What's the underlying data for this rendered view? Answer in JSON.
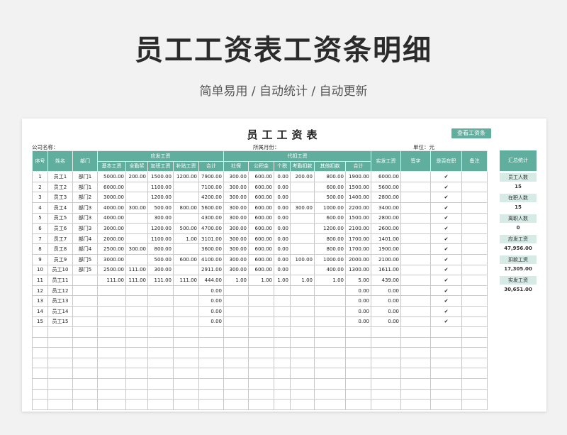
{
  "page": {
    "title": "员工工资表工资条明细",
    "subtitle": "简单易用  /  自动统计  /  自动更新"
  },
  "sheet": {
    "title": "员工工资表",
    "view_button": "查看工资条",
    "company_label": "公司名称：",
    "month_label": "所属月份：",
    "unit_label": "单位：元"
  },
  "headers": {
    "seq": "序号",
    "name": "姓名",
    "dept": "部门",
    "payable_group": "应发工资",
    "withhold_group": "代扣工资",
    "base": "基本工资",
    "attendance": "全勤奖",
    "overtime": "加班工资",
    "allowance": "补贴工资",
    "payable_total": "合计",
    "social": "社保",
    "fund": "公积金",
    "tax": "个税",
    "absence": "考勤扣款",
    "other": "其他扣款",
    "withhold_total": "合计",
    "net": "实发工资",
    "sign": "签字",
    "employed": "是否在职",
    "remark": "备注"
  },
  "rows": [
    [
      "1",
      "员工1",
      "部门1",
      "5000.00",
      "200.00",
      "1500.00",
      "1200.00",
      "7900.00",
      "300.00",
      "600.00",
      "0.00",
      "200.00",
      "800.00",
      "1900.00",
      "6000.00",
      "",
      "✔",
      ""
    ],
    [
      "2",
      "员工2",
      "部门1",
      "6000.00",
      "",
      "1100.00",
      "",
      "7100.00",
      "300.00",
      "600.00",
      "0.00",
      "",
      "600.00",
      "1500.00",
      "5600.00",
      "",
      "✔",
      ""
    ],
    [
      "3",
      "员工3",
      "部门2",
      "3000.00",
      "",
      "1200.00",
      "",
      "4200.00",
      "300.00",
      "600.00",
      "0.00",
      "",
      "500.00",
      "1400.00",
      "2800.00",
      "",
      "✔",
      ""
    ],
    [
      "4",
      "员工4",
      "部门3",
      "4000.00",
      "300.00",
      "500.00",
      "800.00",
      "5600.00",
      "300.00",
      "600.00",
      "0.00",
      "300.00",
      "1000.00",
      "2200.00",
      "3400.00",
      "",
      "✔",
      ""
    ],
    [
      "5",
      "员工5",
      "部门3",
      "4000.00",
      "",
      "300.00",
      "",
      "4300.00",
      "300.00",
      "600.00",
      "0.00",
      "",
      "600.00",
      "1500.00",
      "2800.00",
      "",
      "✔",
      ""
    ],
    [
      "6",
      "员工6",
      "部门3",
      "3000.00",
      "",
      "1200.00",
      "500.00",
      "4700.00",
      "300.00",
      "600.00",
      "0.00",
      "",
      "1200.00",
      "2100.00",
      "2600.00",
      "",
      "✔",
      ""
    ],
    [
      "7",
      "员工7",
      "部门4",
      "2000.00",
      "",
      "1100.00",
      "1.00",
      "3101.00",
      "300.00",
      "600.00",
      "0.00",
      "",
      "800.00",
      "1700.00",
      "1401.00",
      "",
      "✔",
      ""
    ],
    [
      "8",
      "员工8",
      "部门4",
      "2500.00",
      "300.00",
      "800.00",
      "",
      "3600.00",
      "300.00",
      "600.00",
      "0.00",
      "",
      "800.00",
      "1700.00",
      "1900.00",
      "",
      "✔",
      ""
    ],
    [
      "9",
      "员工9",
      "部门5",
      "3000.00",
      "",
      "500.00",
      "600.00",
      "4100.00",
      "300.00",
      "600.00",
      "0.00",
      "100.00",
      "1000.00",
      "2000.00",
      "2100.00",
      "",
      "✔",
      ""
    ],
    [
      "10",
      "员工10",
      "部门5",
      "2500.00",
      "111.00",
      "300.00",
      "",
      "2911.00",
      "300.00",
      "600.00",
      "0.00",
      "",
      "400.00",
      "1300.00",
      "1611.00",
      "",
      "✔",
      ""
    ],
    [
      "11",
      "员工11",
      "",
      "111.00",
      "111.00",
      "111.00",
      "111.00",
      "444.00",
      "1.00",
      "1.00",
      "1.00",
      "1.00",
      "1.00",
      "5.00",
      "439.00",
      "",
      "✔",
      ""
    ],
    [
      "12",
      "员工12",
      "",
      "",
      "",
      "",
      "",
      "0.00",
      "",
      "",
      "",
      "",
      "",
      "0.00",
      "0.00",
      "",
      "✔",
      ""
    ],
    [
      "13",
      "员工13",
      "",
      "",
      "",
      "",
      "",
      "0.00",
      "",
      "",
      "",
      "",
      "",
      "0.00",
      "0.00",
      "",
      "✔",
      ""
    ],
    [
      "14",
      "员工14",
      "",
      "",
      "",
      "",
      "",
      "0.00",
      "",
      "",
      "",
      "",
      "",
      "0.00",
      "0.00",
      "",
      "✔",
      ""
    ],
    [
      "15",
      "员工15",
      "",
      "",
      "",
      "",
      "",
      "0.00",
      "",
      "",
      "",
      "",
      "",
      "0.00",
      "0.00",
      "",
      "✔",
      ""
    ]
  ],
  "empty_rows": 8,
  "summary": {
    "title": "汇总统计",
    "items": [
      {
        "label": "员工人数",
        "value": "15"
      },
      {
        "label": "在职人数",
        "value": "15"
      },
      {
        "label": "离职人数",
        "value": "0"
      },
      {
        "label": "应发工资",
        "value": "47,956.00"
      },
      {
        "label": "扣款工资",
        "value": "17,305.00"
      },
      {
        "label": "实发工资",
        "value": "30,651.00"
      }
    ]
  },
  "colors": {
    "accent": "#5fae9e",
    "summary_label_bg": "#d6ebe6"
  }
}
